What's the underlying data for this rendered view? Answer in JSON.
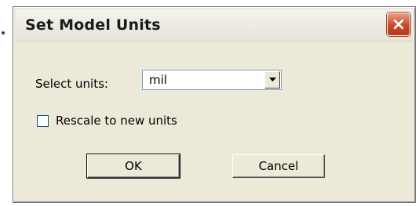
{
  "window": {
    "title": "Set Model Units",
    "close_icon": "close-icon"
  },
  "units": {
    "label": "Select units:",
    "selected": "mil"
  },
  "rescale": {
    "label": "Rescale to new units",
    "checked": false
  },
  "buttons": {
    "ok": "OK",
    "cancel": "Cancel"
  },
  "colors": {
    "dialog_bg": "#ece9d8",
    "close_button": "#c9492a"
  }
}
